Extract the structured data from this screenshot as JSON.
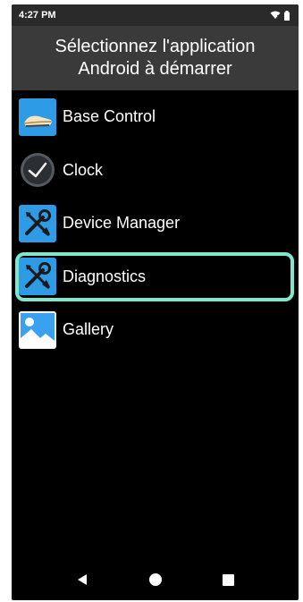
{
  "status_bar": {
    "time": "4:27 PM"
  },
  "header": {
    "line1": "Sélectionnez l'application",
    "line2": "Android à démarrer"
  },
  "apps": [
    {
      "label": "Base Control",
      "icon": "base-control-icon"
    },
    {
      "label": "Clock",
      "icon": "clock-icon"
    },
    {
      "label": "Device Manager",
      "icon": "wrench-screwdriver-icon"
    },
    {
      "label": "Diagnostics",
      "icon": "wrench-screwdriver-icon",
      "highlighted": true
    },
    {
      "label": "Gallery",
      "icon": "gallery-icon"
    }
  ],
  "colors": {
    "highlight": "#7ee8cf",
    "icon_blue": "#2e9be6",
    "header_bg": "#3a3a3a"
  },
  "nav": {
    "icons": [
      "back-icon",
      "home-icon",
      "recents-icon"
    ]
  }
}
